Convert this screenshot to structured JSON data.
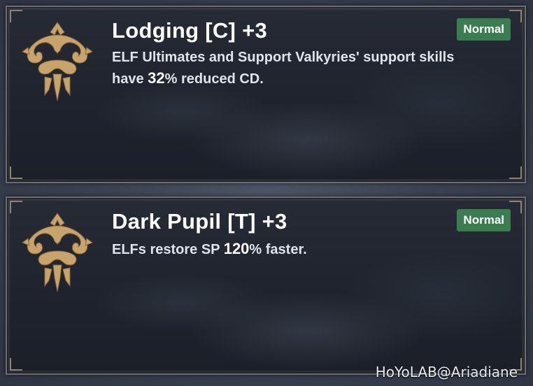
{
  "cards": [
    {
      "title": "Lodging [C] +3",
      "badge": "Normal",
      "desc_before": "ELF Ultimates and Support Valkyries' support skills have ",
      "desc_value": "32",
      "desc_after": "% reduced CD.",
      "icon": "elf-crest-icon"
    },
    {
      "title": "Dark Pupil [T] +3",
      "badge": "Normal",
      "desc_before": "ELFs restore SP ",
      "desc_value": "120",
      "desc_after": "% faster.",
      "icon": "elf-crest-icon"
    }
  ],
  "watermark": "HoYoLAB@Ariadiane",
  "colors": {
    "badge": "#3a7d4e",
    "emblem_gold": "#c9a46a",
    "card_bg": "#1e232d"
  }
}
